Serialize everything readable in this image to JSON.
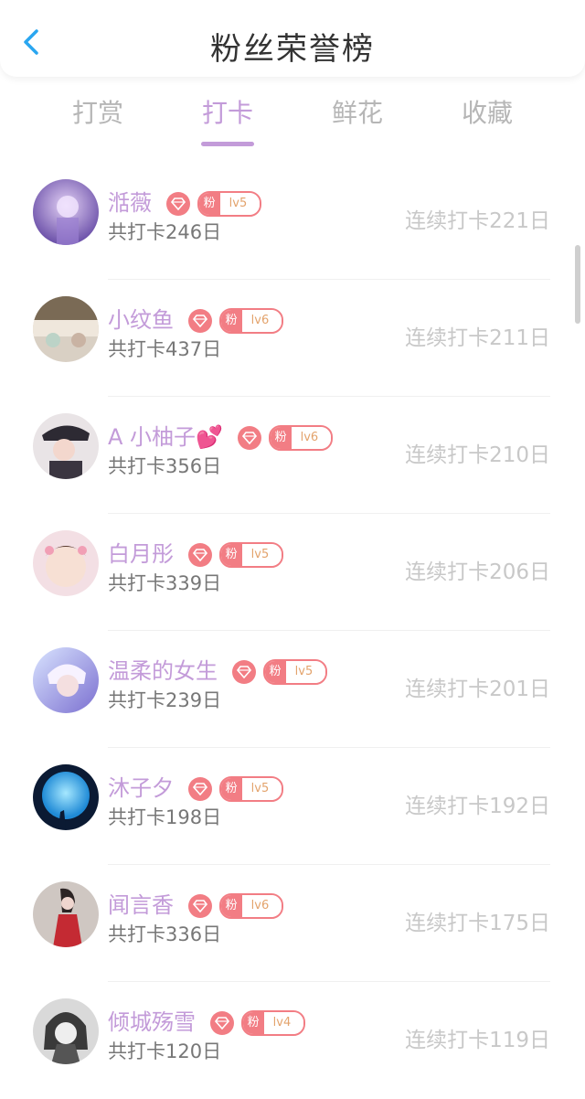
{
  "header": {
    "title": "粉丝荣誉榜"
  },
  "tabs": [
    {
      "label": "打赏"
    },
    {
      "label": "打卡"
    },
    {
      "label": "鲜花"
    },
    {
      "label": "收藏"
    }
  ],
  "fan_badge_text": "粉",
  "users": [
    {
      "name": "湉薇",
      "emoji": "",
      "level": "lv5",
      "total": "共打卡246日",
      "streak": "连续打卡221日"
    },
    {
      "name": "小纹鱼",
      "emoji": "",
      "level": "lv6",
      "total": "共打卡437日",
      "streak": "连续打卡211日"
    },
    {
      "name": "A 小柚子",
      "emoji": "💕",
      "level": "lv6",
      "total": "共打卡356日",
      "streak": "连续打卡210日"
    },
    {
      "name": "白月彤",
      "emoji": "",
      "level": "lv5",
      "total": "共打卡339日",
      "streak": "连续打卡206日"
    },
    {
      "name": "温柔的女生",
      "emoji": "",
      "level": "lv5",
      "total": "共打卡239日",
      "streak": "连续打卡201日"
    },
    {
      "name": "沐子夕",
      "emoji": "",
      "level": "lv5",
      "total": "共打卡198日",
      "streak": "连续打卡192日"
    },
    {
      "name": "闻言香",
      "emoji": "",
      "level": "lv6",
      "total": "共打卡336日",
      "streak": "连续打卡175日"
    },
    {
      "name": "倾城殇雪",
      "emoji": "",
      "level": "lv4",
      "total": "共打卡120日",
      "streak": "连续打卡119日"
    }
  ],
  "colors": {
    "accent": "#c39bd9",
    "badge": "#f27d84",
    "level_text": "#e3a36c",
    "muted": "#c8c8c8"
  },
  "active_tab": "打卡"
}
